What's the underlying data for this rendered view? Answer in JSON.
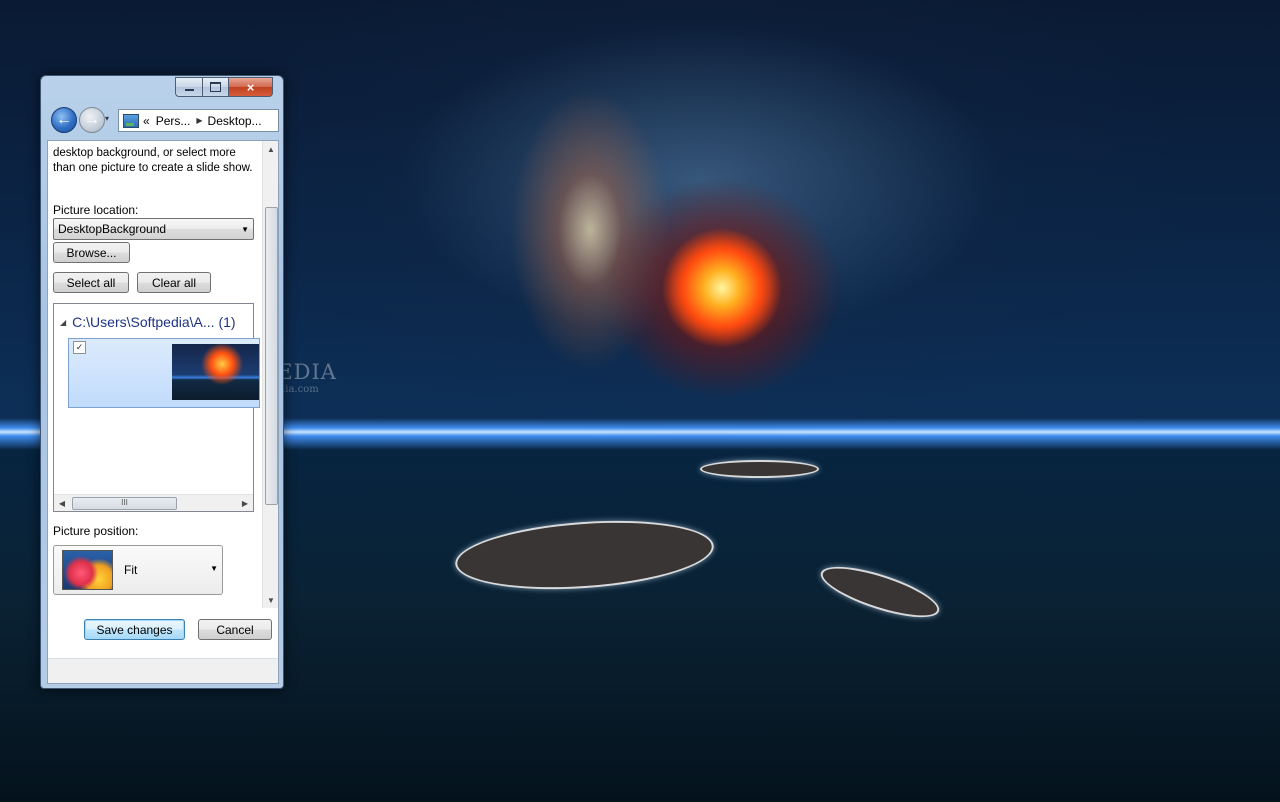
{
  "watermark": {
    "title": "SOFTPEDIA",
    "url": "www.softpedia.com"
  },
  "window": {
    "controls": {
      "minimize": "minimize-icon",
      "maximize": "maximize-icon",
      "close": "×"
    },
    "nav": {
      "back": "←",
      "forward": "→",
      "dropdown": "▾"
    },
    "address": {
      "overflow": "«",
      "crumb1": "Pers...",
      "crumb2": "Desktop...",
      "sep": "▶"
    }
  },
  "panel": {
    "description": "desktop background, or select more than one picture to create a slide show.",
    "picture_location_label": "Picture location:",
    "picture_location_value": "DesktopBackground",
    "browse_label": "Browse...",
    "select_all_label": "Select all",
    "clear_all_label": "Clear all",
    "group_header": "C:\\Users\\Softpedia\\A... (1)",
    "tile_checked": "✓",
    "picture_position_label": "Picture position:",
    "picture_position_value": "Fit",
    "save_label": "Save changes",
    "cancel_label": "Cancel",
    "hscroll_grip": "III"
  },
  "colors": {
    "accent": "#1e3287",
    "selection": "#c1dbfc",
    "close_button": "#c0401f"
  }
}
